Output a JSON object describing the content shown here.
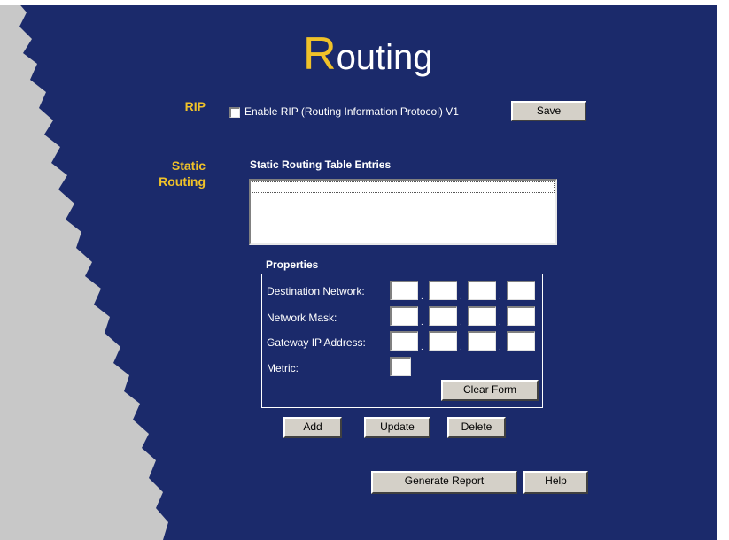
{
  "title": {
    "first_letter": "R",
    "rest": "outing"
  },
  "rip": {
    "section_label": "RIP",
    "checkbox_label": "Enable RIP (Routing Information Protocol) V1",
    "checked": false,
    "save_label": "Save"
  },
  "static_routing": {
    "section_label_line1": "Static",
    "section_label_line2": "Routing",
    "table_heading": "Static Routing Table Entries",
    "entries": []
  },
  "properties": {
    "heading": "Properties",
    "destination_label": "Destination Network:",
    "mask_label": "Network Mask:",
    "gateway_label": "Gateway IP Address:",
    "metric_label": "Metric:",
    "destination": [
      "",
      "",
      "",
      ""
    ],
    "mask": [
      "",
      "",
      "",
      ""
    ],
    "gateway": [
      "",
      "",
      "",
      ""
    ],
    "metric": "",
    "clear_label": "Clear Form"
  },
  "actions": {
    "add_label": "Add",
    "update_label": "Update",
    "delete_label": "Delete",
    "report_label": "Generate Report",
    "help_label": "Help"
  },
  "colors": {
    "background": "#1b2a6b",
    "accent": "#f0c229",
    "sidebar": "#c8c8c8"
  }
}
